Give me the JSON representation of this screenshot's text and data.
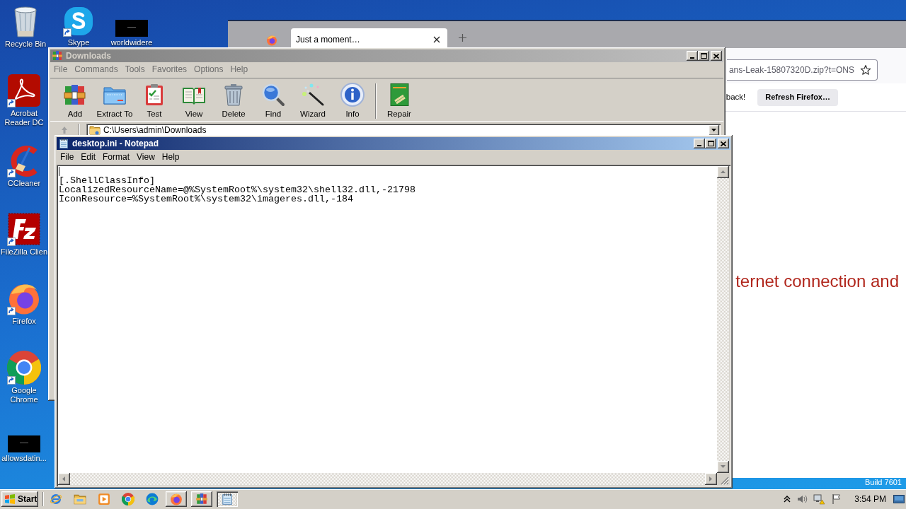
{
  "desktop": {
    "icons": [
      {
        "label": "Recycle Bin",
        "kind": "recycle-bin",
        "shortcut": false
      },
      {
        "label": "Skype",
        "kind": "skype",
        "shortcut": true
      },
      {
        "label": "worldwidere",
        "kind": "thumbnail",
        "shortcut": false
      },
      {
        "label": "Acrobat Reader DC",
        "kind": "acrobat",
        "shortcut": true
      },
      {
        "label": "CCleaner",
        "kind": "ccleaner",
        "shortcut": true
      },
      {
        "label": "FileZilla Clien",
        "kind": "filezilla",
        "shortcut": true
      },
      {
        "label": "Firefox",
        "kind": "firefox",
        "shortcut": true
      },
      {
        "label": "Google Chrome",
        "kind": "chrome",
        "shortcut": true
      },
      {
        "label": "allowsdatin...",
        "kind": "thumbnail",
        "shortcut": false
      }
    ],
    "build_label": "Build 7601"
  },
  "browser": {
    "tabs": [
      {
        "title": "Just a moment…",
        "selected": true
      }
    ],
    "address": "ans-Leak-15807320D.zip?t=ONS",
    "notification": {
      "message": "back!",
      "button": "Refresh Firefox…"
    },
    "page_text": "ternet connection and"
  },
  "archiver": {
    "title": "Downloads",
    "active": false,
    "menu": [
      "File",
      "Commands",
      "Tools",
      "Favorites",
      "Options",
      "Help"
    ],
    "toolbar": [
      {
        "label": "Add",
        "kind": "add"
      },
      {
        "label": "Extract To",
        "kind": "extract"
      },
      {
        "label": "Test",
        "kind": "test"
      },
      {
        "label": "View",
        "kind": "view"
      },
      {
        "label": "Delete",
        "kind": "delete"
      },
      {
        "label": "Find",
        "kind": "find"
      },
      {
        "label": "Wizard",
        "kind": "wizard"
      },
      {
        "label": "Info",
        "kind": "info"
      },
      {
        "label": "Repair",
        "kind": "repair"
      }
    ],
    "path": "C:\\Users\\admin\\Downloads"
  },
  "notepad": {
    "title": "desktop.ini - Notepad",
    "active": true,
    "menu": [
      "File",
      "Edit",
      "Format",
      "View",
      "Help"
    ],
    "lines": [
      "[.ShellClassInfo]",
      "LocalizedResourceName=@%SystemRoot%\\system32\\shell32.dll,-21798",
      "IconResource=%SystemRoot%\\system32\\imageres.dll,-184"
    ]
  },
  "taskbar": {
    "start": "Start",
    "tasks": [
      {
        "kind": "firefox",
        "selected": false
      },
      {
        "kind": "archiver",
        "selected": false
      },
      {
        "kind": "notepad",
        "selected": true
      }
    ],
    "clock": "3:54 PM"
  }
}
